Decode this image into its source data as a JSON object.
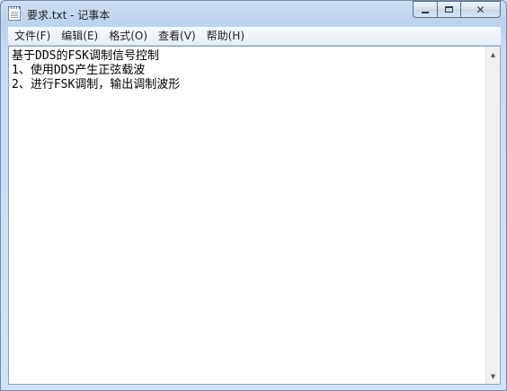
{
  "window": {
    "title": "要求.txt - 记事本",
    "icon": "notepad-icon",
    "controls": {
      "minimize_icon": "minimize-icon",
      "maximize_icon": "maximize-icon",
      "close_icon": "close-icon",
      "close_glyph": "✕"
    }
  },
  "menu": {
    "items": [
      {
        "label": "文件(F)"
      },
      {
        "label": "编辑(E)"
      },
      {
        "label": "格式(O)"
      },
      {
        "label": "查看(V)"
      },
      {
        "label": "帮助(H)"
      }
    ]
  },
  "document": {
    "lines": [
      "基于DDS的FSK调制信号控制",
      "1、使用DDS产生正弦载波",
      "2、进行FSK调制，输出调制波形"
    ]
  },
  "scrollbar": {
    "up_glyph": "▲",
    "down_glyph": "▼"
  }
}
